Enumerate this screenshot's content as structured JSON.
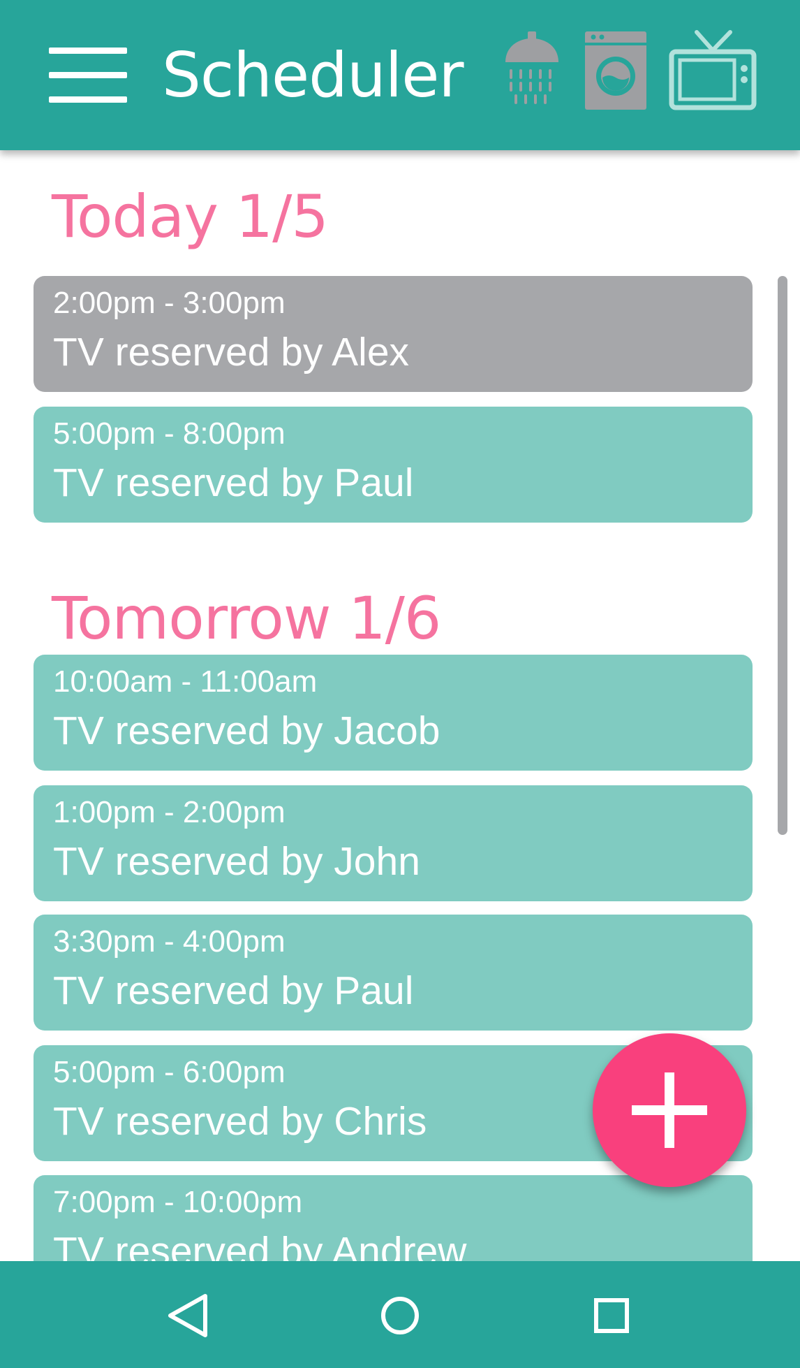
{
  "app": {
    "title": "Scheduler",
    "menu_icon": "hamburger-menu-icon",
    "category_icons": [
      "shower-icon",
      "washing-machine-icon",
      "tv-icon"
    ]
  },
  "colors": {
    "primary": "#27a59a",
    "card": "#80cbc1",
    "past_card": "#a6a7aa",
    "heading": "#f5739f",
    "accent": "#f9407d",
    "inactive_icon": "#9e9fa2",
    "active_icon": "#b2e2dc"
  },
  "days": [
    {
      "heading": "Today 1/5",
      "reservations": [
        {
          "time": "2:00pm - 3:00pm",
          "label": "TV reserved by Alex",
          "past": true
        },
        {
          "time": "5:00pm - 8:00pm",
          "label": "TV reserved by Paul",
          "past": false
        }
      ]
    },
    {
      "heading": "Tomorrow 1/6",
      "reservations": [
        {
          "time": "10:00am - 11:00am",
          "label": "TV reserved by Jacob",
          "past": false
        },
        {
          "time": "1:00pm - 2:00pm",
          "label": "TV reserved by John",
          "past": false
        },
        {
          "time": "3:30pm - 4:00pm",
          "label": "TV reserved by Paul",
          "past": false
        },
        {
          "time": "5:00pm - 6:00pm",
          "label": "TV reserved by Chris",
          "past": false
        },
        {
          "time": "7:00pm - 10:00pm",
          "label": "TV reserved by Andrew",
          "past": false
        }
      ]
    }
  ],
  "fab": {
    "icon": "plus-icon"
  },
  "navbar": {
    "icons": [
      "back-triangle-icon",
      "home-circle-icon",
      "recents-square-icon"
    ]
  }
}
